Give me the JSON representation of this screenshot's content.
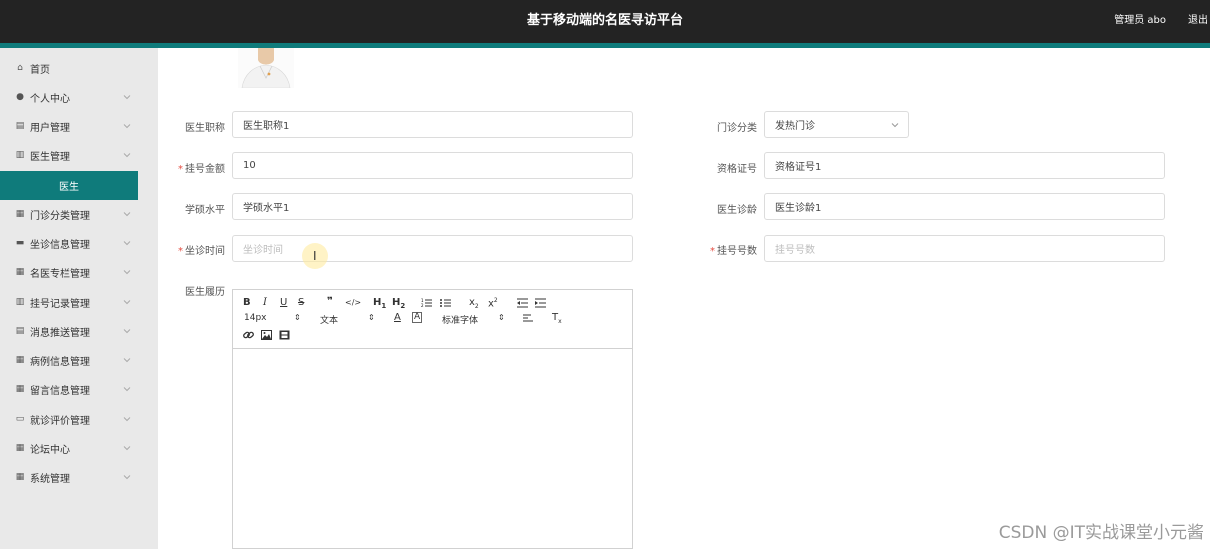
{
  "header": {
    "title": "基于移动端的名医寻访平台",
    "user": "管理员 abo",
    "logout": "退出"
  },
  "sidebar": {
    "items": [
      {
        "label": "首页",
        "icon": "home-icon",
        "expandable": false
      },
      {
        "label": "个人中心",
        "icon": "person-icon",
        "expandable": true
      },
      {
        "label": "用户管理",
        "icon": "clipboard-icon",
        "expandable": true
      },
      {
        "label": "医生管理",
        "icon": "bar-chart-icon",
        "expandable": true
      },
      {
        "label": "门诊分类管理",
        "icon": "grid-icon",
        "expandable": true
      },
      {
        "label": "坐诊信息管理",
        "icon": "database-icon",
        "expandable": true
      },
      {
        "label": "名医专栏管理",
        "icon": "grid-icon",
        "expandable": true
      },
      {
        "label": "挂号记录管理",
        "icon": "bar-chart-icon",
        "expandable": true
      },
      {
        "label": "消息推送管理",
        "icon": "clipboard-icon",
        "expandable": true
      },
      {
        "label": "病例信息管理",
        "icon": "grid-icon",
        "expandable": true
      },
      {
        "label": "留言信息管理",
        "icon": "grid-icon",
        "expandable": true
      },
      {
        "label": "就诊评价管理",
        "icon": "id-card-icon",
        "expandable": true
      },
      {
        "label": "论坛中心",
        "icon": "grid-icon",
        "expandable": true
      },
      {
        "label": "系统管理",
        "icon": "grid-icon",
        "expandable": true
      }
    ],
    "active_sub": "医生"
  },
  "form": {
    "title_label": "医生职称",
    "title_value": "医生职称1",
    "clinic_label": "门诊分类",
    "clinic_value": "发热门诊",
    "fee_label": "挂号金额",
    "fee_value": "10",
    "cert_label": "资格证号",
    "cert_value": "资格证号1",
    "edu_label": "学硕水平",
    "edu_value": "学硕水平1",
    "age_label": "医生诊龄",
    "age_value": "医生诊龄1",
    "time_label": "坐诊时间",
    "time_placeholder": "坐诊时间",
    "count_label": "挂号号数",
    "count_placeholder": "挂号号数",
    "resume_label": "医生履历"
  },
  "editor": {
    "font_size": "14px",
    "heading_type": "文本",
    "font_family": "标准字体"
  },
  "watermark": "CSDN @IT实战课堂小元酱",
  "colors": {
    "header_bg": "#232323",
    "accent": "#0f7b7b",
    "sidebar_bg": "#e9e9e9",
    "required": "#e54d42"
  }
}
